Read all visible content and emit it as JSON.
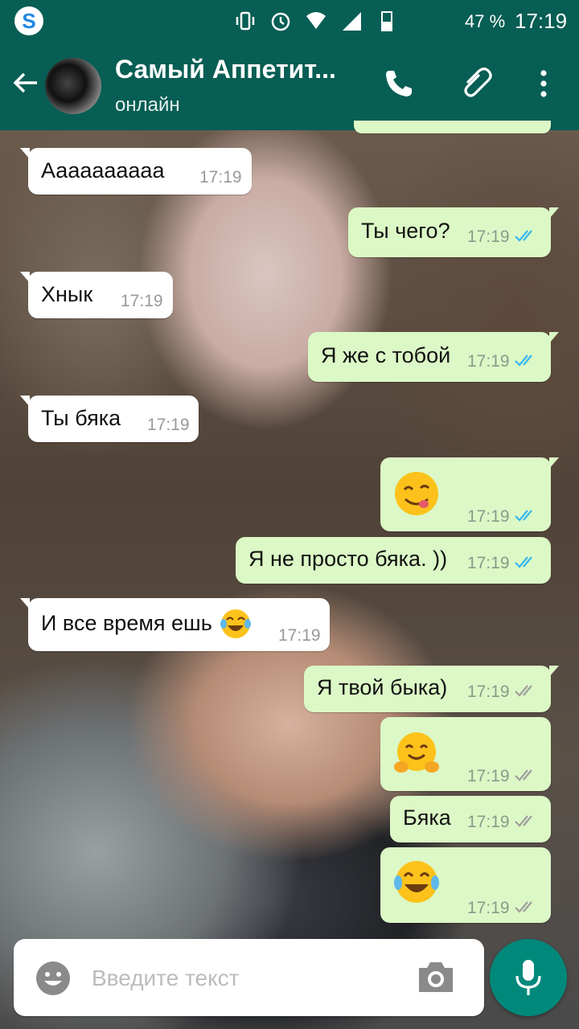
{
  "status_bar": {
    "app_icon": "s-icon",
    "icons": [
      "vibrate-icon",
      "alarm-icon",
      "wifi-icon",
      "signal-icon",
      "battery-icon"
    ],
    "battery_percent": "47 %",
    "time": "17:19"
  },
  "header": {
    "contact_name": "Самый Аппетит...",
    "status": "онлайн",
    "back_icon": "arrow-left-icon",
    "actions": [
      "phone-icon",
      "paperclip-icon",
      "more-vert-icon"
    ]
  },
  "messages": [
    {
      "dir": "in",
      "text": "Аааааааааа",
      "time": "17:19"
    },
    {
      "dir": "out",
      "text": "Ты чего?",
      "time": "17:19",
      "ticks": "read"
    },
    {
      "dir": "in",
      "text": "Хнык",
      "time": "17:19"
    },
    {
      "dir": "out",
      "text": "Я же с тобой",
      "time": "17:19",
      "ticks": "read"
    },
    {
      "dir": "in",
      "text": "Ты бяка",
      "time": "17:19"
    },
    {
      "dir": "out",
      "emoji": "yum-face-emoji",
      "time": "17:19",
      "ticks": "read"
    },
    {
      "dir": "out",
      "text": "Я не просто бяка. ))",
      "time": "17:19",
      "ticks": "read"
    },
    {
      "dir": "in",
      "text": "И все время ешь",
      "emoji_suffix": "joy-emoji",
      "time": "17:19"
    },
    {
      "dir": "out",
      "text": "Я твой быка)",
      "time": "17:19",
      "ticks": "delivered"
    },
    {
      "dir": "out",
      "emoji": "hug-face-emoji",
      "time": "17:19",
      "ticks": "delivered"
    },
    {
      "dir": "out",
      "text": "Бяка",
      "time": "17:19",
      "ticks": "delivered"
    },
    {
      "dir": "out",
      "emoji": "joy-emoji",
      "time": "17:19",
      "ticks": "delivered"
    }
  ],
  "composer": {
    "placeholder": "Введите текст",
    "emoji_button": "smiley-icon",
    "camera_button": "camera-icon",
    "mic_button": "mic-icon"
  },
  "colors": {
    "header": "#075e54",
    "outgoing_bubble": "#dcf8c6",
    "incoming_bubble": "#ffffff",
    "read_ticks": "#34b7f1",
    "delivered_ticks": "#9e9e9e",
    "mic_button": "#00897b"
  }
}
